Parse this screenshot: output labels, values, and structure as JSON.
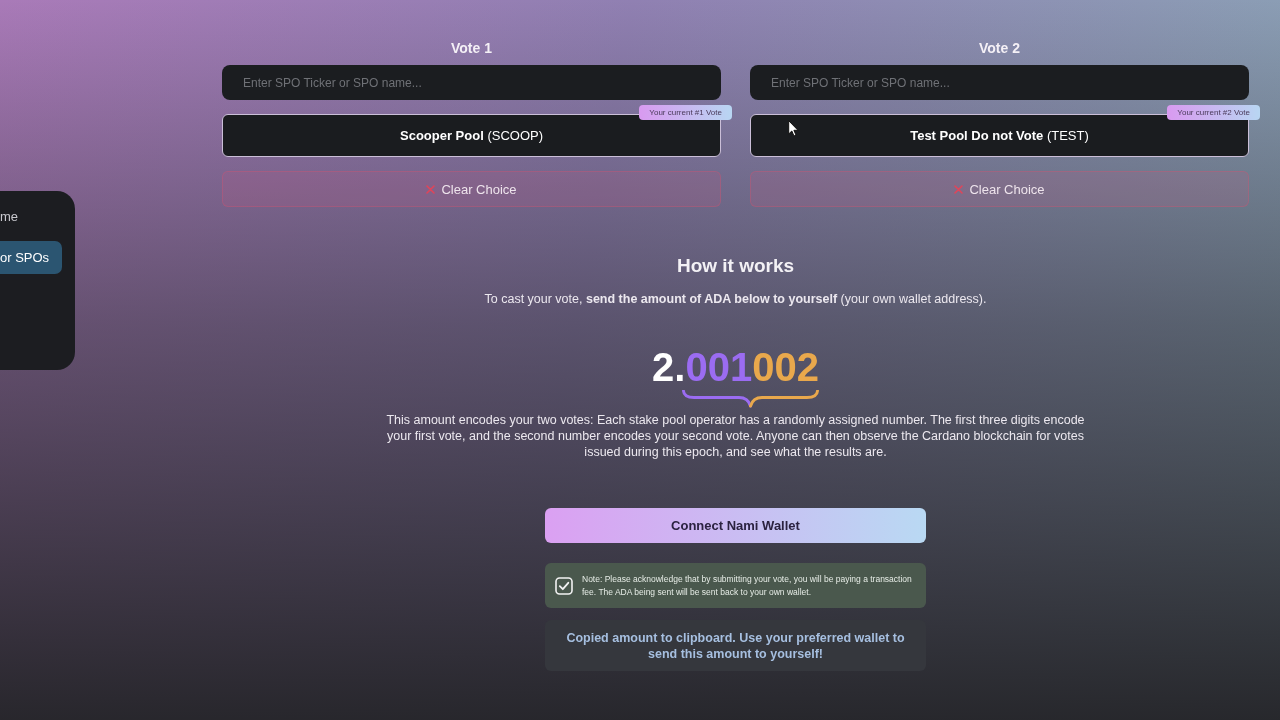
{
  "sidebar": {
    "items": [
      {
        "label": "me",
        "selected": false
      },
      {
        "label": "or SPOs",
        "selected": true
      }
    ]
  },
  "votes": [
    {
      "heading": "Vote 1",
      "search": {
        "placeholder": "Enter SPO Ticker or SPO name..."
      },
      "choice": {
        "label": "**Scooper Pool** (SCOOP)",
        "badge": "Your current #1 Vote"
      },
      "clear_button": "Clear Choice"
    },
    {
      "heading": "Vote 2",
      "search": {
        "placeholder": "Enter SPO Ticker or SPO name..."
      },
      "choice": {
        "label": "**Test Pool Do not Vote** (TEST)",
        "badge": "Your current #2 Vote"
      },
      "clear_button": "Clear Choice"
    }
  ],
  "how_it_works": {
    "title": "How it works",
    "intro": "To cast your vote, **send the amount of ADA below to yourself** (your own wallet address).",
    "amount": {
      "parts": [
        {
          "text": "2.",
          "color": "#ffffff"
        },
        {
          "text": "001",
          "color": "#9b6cf2"
        },
        {
          "text": "002",
          "color": "#e9a84c"
        }
      ]
    },
    "explanation": "This amount encodes your two votes: Each stake pool operator has a randomly assigned number. The first three digits encode your first vote, and the second number encodes your second vote. Anyone can then observe the Cardano blockchain for votes issued during this epoch, and see what the results are."
  },
  "connect_button": "Connect Nami Wallet",
  "acknowledgement": {
    "checked": true,
    "text": "Note: Please acknowledge that by submitting your vote, you will be paying a transaction fee. The ADA being sent will be sent back to your own wallet."
  },
  "status_message": "Copied amount to clipboard. Use your preferred wallet to send this amount to yourself!"
}
